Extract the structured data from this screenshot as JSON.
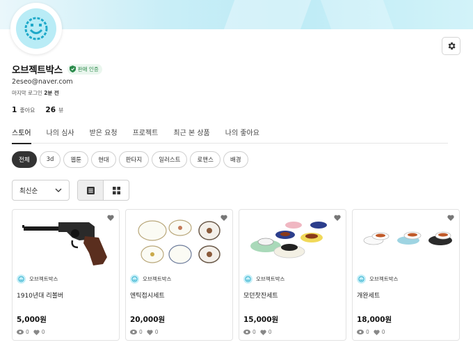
{
  "profile": {
    "name": "오브젝트박스",
    "badge": "판매 인증",
    "email": "2eseo@naver.com",
    "last_login_label": "마지막 로그인",
    "last_login_value": "2분 전",
    "likes_count": "1",
    "likes_label": "좋아요",
    "views_count": "26",
    "views_label": "뷰"
  },
  "tabs": [
    "스토어",
    "나의 심사",
    "받은 요청",
    "프로젝트",
    "최근 본 상품",
    "나의 좋아요"
  ],
  "active_tab": "스토어",
  "filters": [
    "전체",
    "3d",
    "웹툰",
    "현대",
    "판타지",
    "일러스트",
    "로맨스",
    "배경"
  ],
  "active_filter": "전체",
  "sort": {
    "selected": "최신순"
  },
  "products": [
    {
      "seller": "오브젝트박스",
      "title": "1910년대 리볼버",
      "price": "5,000원",
      "views": "0",
      "likes": "0"
    },
    {
      "seller": "오브젝트박스",
      "title": "엔틱접시세트",
      "price": "20,000원",
      "views": "0",
      "likes": "0"
    },
    {
      "seller": "오브젝트박스",
      "title": "모던찻잔세트",
      "price": "15,000원",
      "views": "0",
      "likes": "0"
    },
    {
      "seller": "오브젝트박스",
      "title": "개완세트",
      "price": "18,000원",
      "views": "0",
      "likes": "0"
    }
  ],
  "colors": {
    "accent": "#333333",
    "banner": "#bdebf6",
    "verified": "#2a8a4a"
  }
}
